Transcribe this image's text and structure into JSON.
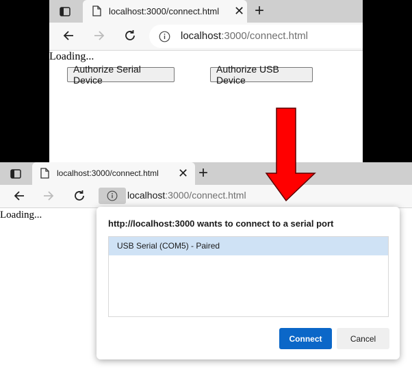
{
  "window_top": {
    "tab_title": "localhost:3000/connect.html",
    "url_host": "localhost",
    "url_path": ":3000/connect.html",
    "page": {
      "loading_text": "Loading...",
      "authorize_serial_label": "Authorize Serial Device",
      "authorize_usb_label": "Authorize USB Device"
    }
  },
  "window_bottom": {
    "tab_title": "localhost:3000/connect.html",
    "url_host": "localhost",
    "url_path": ":3000/connect.html",
    "page": {
      "loading_text": "Loading..."
    },
    "serial_dialog": {
      "title": "http://localhost:3000 wants to connect to a serial port",
      "devices": [
        {
          "label": "USB Serial (COM5) - Paired",
          "selected": true
        }
      ],
      "connect_label": "Connect",
      "cancel_label": "Cancel"
    }
  },
  "colors": {
    "arrow": "#ff0000",
    "connect_button": "#0b67c8",
    "selected_item": "#cfe2f5"
  },
  "icons": [
    "sidebar-icon",
    "page-icon",
    "close-icon",
    "plus-icon",
    "back-arrow-icon",
    "forward-arrow-icon",
    "reload-icon",
    "info-icon",
    "down-arrow-icon"
  ]
}
